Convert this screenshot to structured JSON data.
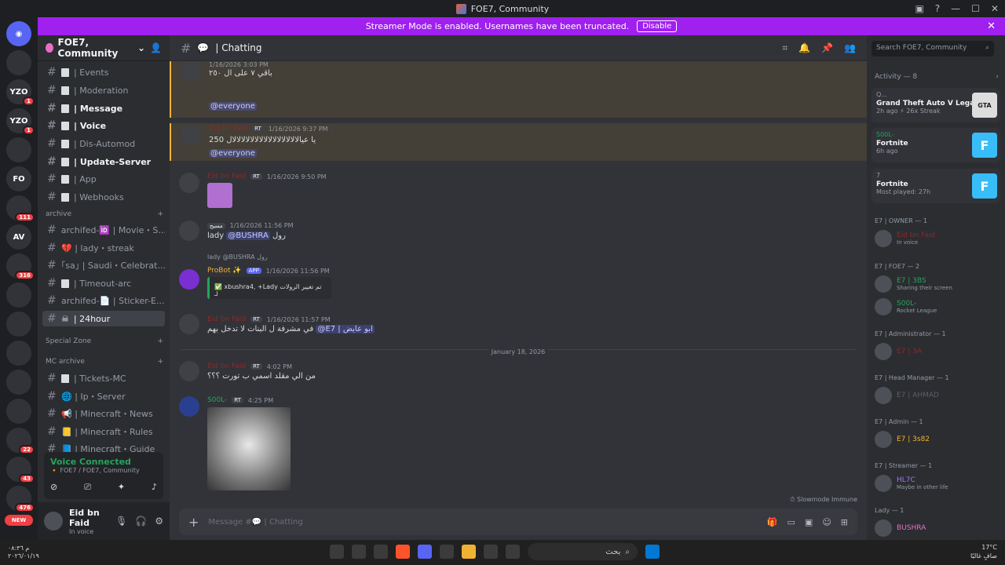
{
  "window": {
    "title": "FOE7, Community"
  },
  "banner": {
    "text": "Streamer Mode is enabled. Usernames have been truncated.",
    "button": "Disable"
  },
  "servers": [
    {
      "label": "",
      "badge": ""
    },
    {
      "label": "YZO",
      "badge": "1"
    },
    {
      "label": "YZO",
      "badge": "1"
    },
    {
      "label": "",
      "badge": ""
    },
    {
      "label": "FO",
      "badge": ""
    },
    {
      "label": "",
      "badge": "111"
    },
    {
      "label": "AV",
      "badge": ""
    },
    {
      "label": "",
      "badge": "316"
    },
    {
      "label": "",
      "badge": ""
    },
    {
      "label": "",
      "badge": ""
    },
    {
      "label": "",
      "badge": ""
    },
    {
      "label": "",
      "badge": ""
    },
    {
      "label": "",
      "badge": ""
    },
    {
      "label": "",
      "badge": "22"
    },
    {
      "label": "",
      "badge": "43"
    },
    {
      "label": "",
      "badge": "476"
    }
  ],
  "new_label": "NEW",
  "guild": {
    "name": "FOE7, Community"
  },
  "channels": [
    {
      "name": "| Events"
    },
    {
      "name": "| Moderation"
    },
    {
      "name": "| Message"
    },
    {
      "name": "| Voice"
    },
    {
      "name": "| Dis-Automod"
    },
    {
      "name": "| Update-Server"
    },
    {
      "name": "| App"
    },
    {
      "name": "| Webhooks"
    }
  ],
  "category_archive": "archive",
  "archive_channels": [
    {
      "name": "archifed-🆔 | Movie・S..."
    },
    {
      "name": "💔 | lady・streak"
    },
    {
      "name": "｢sa｣ | Saudi・Celebrat..."
    },
    {
      "name": "| Timeout-arc"
    },
    {
      "name": "archifed-📄 | Sticker-E..."
    },
    {
      "name": "| 24hour"
    }
  ],
  "category_special": "Special Zone",
  "category_mc": "MC archive",
  "mc_channels": [
    {
      "name": "| Tickets-MC"
    },
    {
      "name": "🌐 | Ip・Server"
    },
    {
      "name": "📢 | Minecraft・News"
    },
    {
      "name": "📒 | Minecraft・Rules"
    },
    {
      "name": "📘 | Minecraft・Guide"
    }
  ],
  "voice": {
    "title": "Voice Connected",
    "sub": "🔸 FOE7 / FOE7, Community"
  },
  "user": {
    "name": "Eid bn Faid",
    "status": "In voice"
  },
  "channel_header": {
    "name": "| Chatting",
    "search": "Search FOE7, Community"
  },
  "messages": {
    "m1": {
      "time": "1/16/2026 3:03 PM",
      "text": "باقي ٧ على ال ٢٥٠",
      "mention": "@everyone"
    },
    "m2": {
      "author": "Eid bn Faid",
      "tag": "RT",
      "time": "1/16/2026 9:37 PM",
      "text": "250 يا عيالالالالالالالالالالالالالالالال",
      "mention": "@everyone"
    },
    "m3": {
      "author": "Eid bn Faid",
      "tag": "RT",
      "time": "1/16/2026 9:50 PM"
    },
    "m4": {
      "tag": "مسيح",
      "time": "1/16/2026 11:56 PM",
      "text_pre": "lady",
      "mention": "@BUSHRA",
      "text_post": "رول"
    },
    "m5": {
      "reply": "lady @BUSHRA رول",
      "author": "ProBot ✨",
      "tag": "APP",
      "time": "1/16/2026 11:56 PM",
      "embed": "✅ xbushra4, +Lady تم تغيير الرولات لـ"
    },
    "m6": {
      "author": "Eid bn Faid",
      "tag": "RT",
      "time": "1/16/2026 11:57 PM",
      "text": "في مشرفة ل البنات لا تدخل بهم",
      "mention": "@E7 | ابو عايض"
    },
    "divider": "January 18, 2026",
    "m7": {
      "author": "Eid bn Faid",
      "tag": "RT",
      "time": "4:02 PM",
      "text": "من الي مقلد اسمي ب تورت ؟؟؟"
    },
    "m8": {
      "author": "S00L-",
      "tag": "RT",
      "time": "4:25 PM"
    }
  },
  "slowmode": "Slowmode Immune",
  "composer": {
    "placeholder": "Message #💬 | Chatting"
  },
  "activity": {
    "header": "Activity — 8",
    "cards": [
      {
        "user": "Q...",
        "game": "Grand Theft Auto V Legacy",
        "meta": "2h ago  ⚡ 26x Streak",
        "art": "GTA"
      },
      {
        "user": "S00L-",
        "game": "Fortnite",
        "meta": "6h ago",
        "art": "F"
      },
      {
        "user": "7",
        "game": "Fortnite",
        "meta": "Most played: 27h",
        "art": "F"
      }
    ]
  },
  "roles": [
    {
      "title": "E7 | OWNER — 1",
      "members": [
        {
          "name": "Eid bn Faid",
          "tag": "RT",
          "sub": "In voice",
          "color": "#8b2a2a"
        }
      ]
    },
    {
      "title": "E7 | FOE7 — 2",
      "members": [
        {
          "name": "E7 | 3BS",
          "tag": "",
          "sub": "Sharing their screen",
          "color": "#23a55a"
        },
        {
          "name": "S00L-",
          "tag": "RT",
          "sub": "Rocket League",
          "color": "#23a55a"
        }
      ]
    },
    {
      "title": "E7 | Administrator — 1",
      "members": [
        {
          "name": "E7 | 3A",
          "tag": "",
          "sub": "",
          "color": "#8b2a2a"
        }
      ]
    },
    {
      "title": "E7 | Head Manager — 1",
      "members": [
        {
          "name": "E7 | AHMAD",
          "tag": "RT",
          "sub": "",
          "color": "#1e1f22"
        }
      ]
    },
    {
      "title": "E7 | Admin — 1",
      "members": [
        {
          "name": "E7 | 3s82",
          "tag": "شفع",
          "sub": "",
          "color": "#f0b232"
        }
      ]
    },
    {
      "title": "E7 | Streamer — 1",
      "members": [
        {
          "name": "HL7C",
          "tag": "RT",
          "sub": "Maybe in other life",
          "color": "#a970ff"
        }
      ]
    },
    {
      "title": "Lady — 1",
      "members": [
        {
          "name": "BUSHRA",
          "tag": "",
          "sub": "",
          "color": "#e86fc4"
        }
      ]
    }
  ],
  "taskbar": {
    "search": "بحث",
    "weather": "17°C",
    "weather_sub": "صافٍ غالبًا",
    "time": "م ٠٨:٣٦",
    "date": "٢٠٢٦/٠١/١٩"
  }
}
